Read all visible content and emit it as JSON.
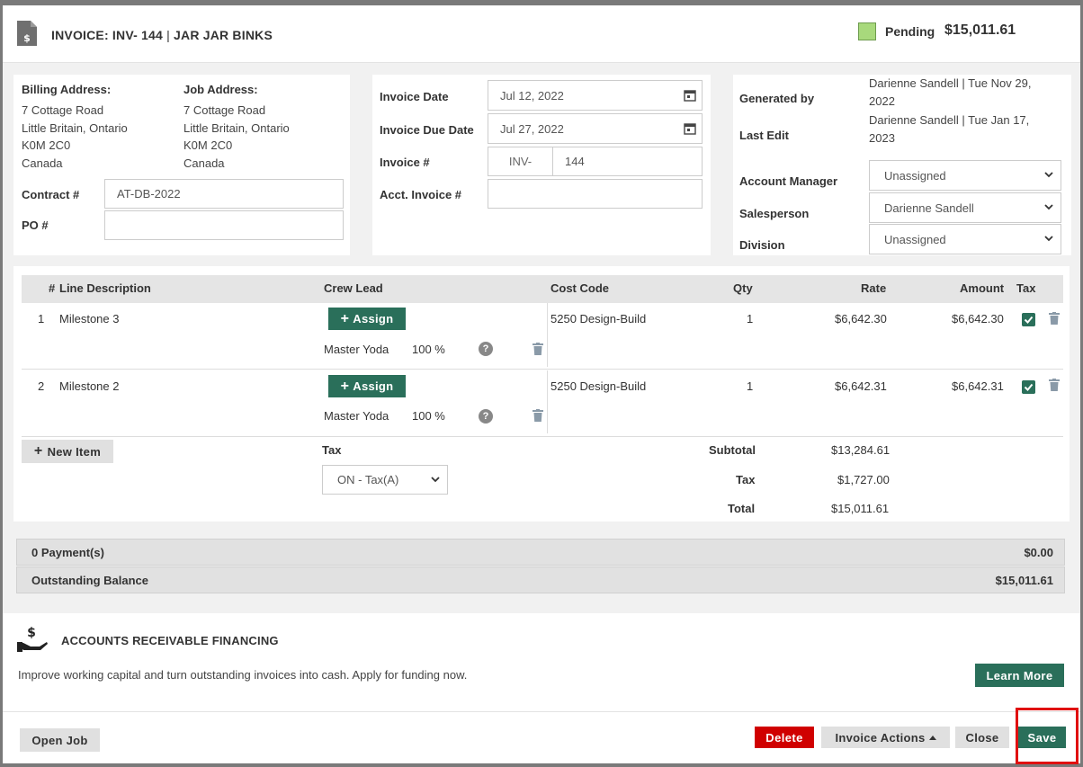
{
  "header": {
    "title_prefix": "INVOICE: INV- 144",
    "title_sep": " | ",
    "title_customer": "JAR JAR BINKS",
    "status": "Pending",
    "status_color": "#a8d97c",
    "total": "$15,011.61"
  },
  "billing": {
    "billing_label": "Billing Address:",
    "billing_lines": [
      "7 Cottage Road",
      "Little Britain, Ontario",
      "K0M 2C0",
      "Canada"
    ],
    "job_label": "Job Address:",
    "job_lines": [
      "7 Cottage Road",
      "Little Britain, Ontario",
      "K0M 2C0",
      "Canada"
    ],
    "contract_label": "Contract #",
    "contract_value": "AT-DB-2022",
    "po_label": "PO #",
    "po_value": ""
  },
  "dates": {
    "invoice_date_label": "Invoice Date",
    "invoice_date": "Jul 12, 2022",
    "due_date_label": "Invoice Due Date",
    "due_date": "Jul 27, 2022",
    "invoice_num_label": "Invoice #",
    "invoice_prefix": "INV-",
    "invoice_num": "144",
    "acct_invoice_label": "Acct. Invoice #",
    "acct_invoice": ""
  },
  "meta": {
    "generated_label": "Generated by",
    "generated_line1": "Darienne Sandell | Tue Nov 29,",
    "generated_line2": "2022",
    "last_edit_label": "Last Edit",
    "last_edit_line1": "Darienne Sandell | Tue Jan 17,",
    "last_edit_line2": "2023",
    "account_manager_label": "Account Manager",
    "account_manager": "Unassigned",
    "salesperson_label": "Salesperson",
    "salesperson": "Darienne Sandell",
    "division_label": "Division",
    "division": "Unassigned"
  },
  "table": {
    "headers": {
      "num": "#",
      "desc": "Line Description",
      "crew": "Crew Lead",
      "cost": "Cost Code",
      "qty": "Qty",
      "rate": "Rate",
      "amount": "Amount",
      "tax": "Tax"
    },
    "assign_label": "Assign",
    "rows": [
      {
        "num": "1",
        "desc": "Milestone 3",
        "crew_name": "Master Yoda",
        "crew_pct": "100 %",
        "cost_code": "5250 Design-Build",
        "qty": "1",
        "rate": "$6,642.30",
        "amount": "$6,642.30"
      },
      {
        "num": "2",
        "desc": "Milestone 2",
        "crew_name": "Master Yoda",
        "crew_pct": "100 %",
        "cost_code": "5250 Design-Build",
        "qty": "1",
        "rate": "$6,642.31",
        "amount": "$6,642.31"
      }
    ]
  },
  "totals": {
    "new_item_label": "New Item",
    "tax_label": "Tax",
    "tax_select": "ON - Tax(A)",
    "subtotal_label": "Subtotal",
    "subtotal": "$13,284.61",
    "tax_total_label": "Tax",
    "tax_total": "$1,727.00",
    "total_label": "Total",
    "total": "$15,011.61"
  },
  "payments": {
    "payments_label": "0 Payment(s)",
    "payments_amount": "$0.00",
    "balance_label": "Outstanding Balance",
    "balance_amount": "$15,011.61"
  },
  "financing": {
    "title": "ACCOUNTS RECEIVABLE FINANCING",
    "description": "Improve working capital and turn outstanding invoices into cash. Apply for funding now.",
    "learn_more": "Learn More"
  },
  "footer": {
    "open_job": "Open Job",
    "delete": "Delete",
    "invoice_actions": "Invoice Actions",
    "close": "Close",
    "save": "Save"
  },
  "colors": {
    "accent": "#2a6f5a",
    "danger": "#d00000",
    "highlight": "#e01010"
  }
}
